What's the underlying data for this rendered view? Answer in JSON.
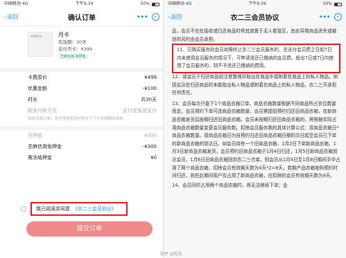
{
  "left": {
    "status": {
      "carrier": "中国移动",
      "network": "4G",
      "time": "下午9:34",
      "battery": "50%"
    },
    "nav": {
      "back": "返回",
      "title": "确认订单",
      "more": "•••"
    },
    "product": {
      "thumb_text": "¥499.00",
      "name": "月卡",
      "validity": "有效期：30天",
      "price_line": "支付币卡：¥399",
      "badge": "芝麻信用·免押金"
    },
    "rows": [
      {
        "label": "卡费原价",
        "value": "¥499"
      },
      {
        "label": "优惠金额",
        "value": "-¥100"
      },
      {
        "label": "时长",
        "value": "共30天"
      }
    ],
    "auto_renew": {
      "label": "租金付款方式",
      "value": "支付宝免密支付"
    },
    "auto_renew_note": "如未完成订单，支付宝免密支付将在下个小时到期后收取",
    "deposit_rows": [
      {
        "label": "总押金",
        "value": "¥300"
      },
      {
        "label": "芝麻信用免押金",
        "value": "-¥300"
      },
      {
        "label": "需冻结押金",
        "value": "¥0"
      }
    ],
    "agree": {
      "prefix": "我已阅读并同意",
      "link": "《衣二三会员协议》"
    },
    "submit": "提交订单"
  },
  "right": {
    "status": {
      "carrier": "中国移动",
      "network": "4G",
      "time": "下午9:34",
      "battery": "50%"
    },
    "nav": {
      "back": "返回",
      "title": "衣二三会员协议",
      "more": "•••"
    },
    "paragraphs": [
      "品，会员不应在接收或归还商品时将其放置于无人看管区，由此导致商品丢失或被窃的风险由会员承担。",
      "11、已购买服务的会员如需终止衣二三会员服务的，在支付会员费之日起7日内未使用会员服务的情况下，可申请退还已缴纳的会员费。超出7日或7日内使用了会员服务的，则不予退还已缴纳的费用。",
      "12、请会员于归还商品前注意整理并取出在商品中或附着在商品上的私人物品。如因会员在归还商品时未能取出私人物品或附着在商品上的私人物品，衣二三不承担任何责任。",
      "13、会员每次只能下1个商品衣箱订单，商品衣箱数量根据不同商品所占衣位数量而定。会员预约下单可选商品衣箱数量，会员需提前预约归还旧商品衣箱，在新商品衣箱发货后按期归还旧商品衣箱。会员未按期归还旧商品衣箱的，将根据实际占用商品衣箱数量变更会员服务数。扣除会员服务数的具体计算公式：双商品衣箱日*商品衣箱数量。双商品衣箱日为自预约归还旧商品衣箱日期的次日起至会员已下单的新商品衣箱的到达日。如会员持有一个旧商品衣箱，1月2日下单新商品衣箱，1月3日新商品衣箱发货，会员预约旧商品衣箱于1月4日归还，1月5日新商品衣箱到达会员，1月6日旧商品衣箱回到衣二三仓库，则会员从1月4日至1月8日期间手中占用了两个商品衣箱，扣除会员有效期天数为4天*2=8天。若期产品衣箱按照预约时间归还，则在此期间用户仅占用了新商品衣箱，应扣除的会员有效期天数为4天。",
      "14、会员同时占用两个商品衣箱时，将无法继续下单；会"
    ],
    "watermark": "知乎 @吃衣"
  }
}
